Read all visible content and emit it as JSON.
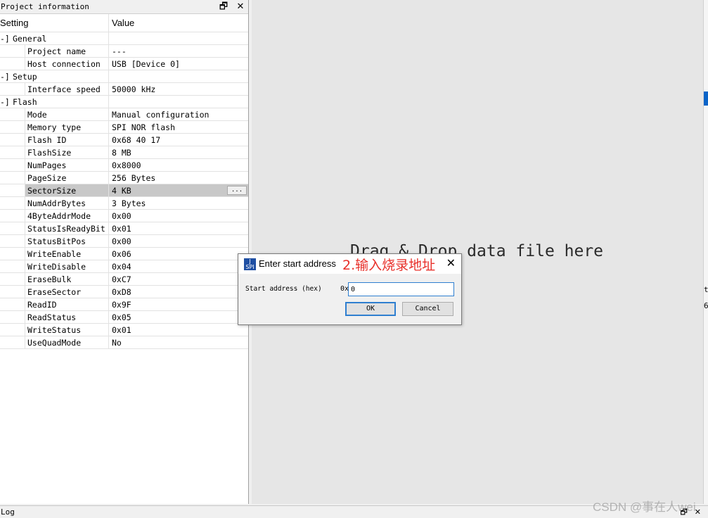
{
  "panel": {
    "title": "Project information",
    "restore_glyph": "🗗",
    "close_glyph": "✕",
    "col_setting": "Setting",
    "col_value": "Value",
    "rows": [
      {
        "type": "group",
        "prefix": "-]",
        "name": "General",
        "value": ""
      },
      {
        "type": "leaf",
        "name": "Project name",
        "value": "---"
      },
      {
        "type": "leaf",
        "name": "Host connection",
        "value": "USB [Device 0]"
      },
      {
        "type": "group",
        "prefix": "-]",
        "name": "Setup",
        "value": ""
      },
      {
        "type": "leaf",
        "name": "Interface speed",
        "value": "50000 kHz"
      },
      {
        "type": "group",
        "prefix": "-]",
        "name": "Flash",
        "value": ""
      },
      {
        "type": "leaf",
        "name": "Mode",
        "value": "Manual configuration"
      },
      {
        "type": "leaf",
        "name": "Memory type",
        "value": "SPI NOR flash"
      },
      {
        "type": "leaf",
        "name": "Flash ID",
        "value": "0x68 40 17"
      },
      {
        "type": "leaf",
        "name": "FlashSize",
        "value": "8 MB"
      },
      {
        "type": "leaf",
        "name": "NumPages",
        "value": "0x8000"
      },
      {
        "type": "leaf",
        "name": "PageSize",
        "value": "256 Bytes"
      },
      {
        "type": "leaf",
        "name": "SectorSize",
        "value": "4 KB",
        "selected": true,
        "button": "..."
      },
      {
        "type": "leaf",
        "name": "NumAddrBytes",
        "value": "3 Bytes"
      },
      {
        "type": "leaf",
        "name": "4ByteAddrMode",
        "value": "0x00"
      },
      {
        "type": "leaf",
        "name": "StatusIsReadyBit",
        "value": "0x01"
      },
      {
        "type": "leaf",
        "name": "StatusBitPos",
        "value": "0x00"
      },
      {
        "type": "leaf",
        "name": "WriteEnable",
        "value": "0x06"
      },
      {
        "type": "leaf",
        "name": "WriteDisable",
        "value": "0x04"
      },
      {
        "type": "leaf",
        "name": "EraseBulk",
        "value": "0xC7"
      },
      {
        "type": "leaf",
        "name": "EraseSector",
        "value": "0xD8"
      },
      {
        "type": "leaf",
        "name": "ReadID",
        "value": "0x9F"
      },
      {
        "type": "leaf",
        "name": "ReadStatus",
        "value": "0x05"
      },
      {
        "type": "leaf",
        "name": "WriteStatus",
        "value": "0x01"
      },
      {
        "type": "leaf",
        "name": "UseQuadMode",
        "value": "No"
      }
    ]
  },
  "drop": {
    "text": "Drag & Drop data file here"
  },
  "right_edge": {
    "t1": "t",
    "t2": "6"
  },
  "log": {
    "title": "Log",
    "restore_glyph": "🗗",
    "close_glyph": "✕"
  },
  "watermark": "CSDN @事在人wei",
  "dialog": {
    "icon_text": "J\nSPI",
    "title": "Enter start address",
    "annotation": "2.输入烧录地址",
    "close_glyph": "✕",
    "label": "Start address (hex)",
    "prefix": "0x",
    "input_value": "0",
    "ok_label": "OK",
    "cancel_label": "Cancel"
  },
  "colors": {
    "accent": "#2f7fd0",
    "annotation": "#e8302a",
    "selected_row": "#c8c8c8"
  }
}
